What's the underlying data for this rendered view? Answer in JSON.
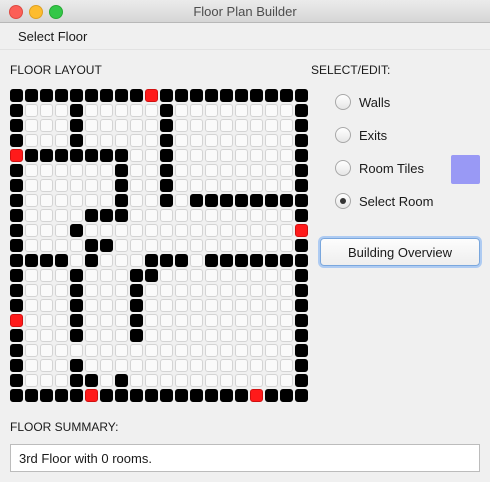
{
  "window": {
    "title": "Floor Plan Builder"
  },
  "menu": {
    "select_floor": "Select Floor"
  },
  "layout": {
    "heading": "FLOOR LAYOUT",
    "legend": {
      "#": "wall",
      ".": "floor",
      "R": "exit"
    },
    "grid": [
      "#########R##########",
      "#...#.....#........#",
      "#...#.....#........#",
      "#...#.....#........#",
      "R#######..#........#",
      "#......#..#........#",
      "#......#..#........#",
      "#......#..#.########",
      "#....###...........#",
      "#...#..............R",
      "#....##............#",
      "####.#...###.#######",
      "#...#...##.........#",
      "#...#...#..........#",
      "#...#...#..........#",
      "R...#...#..........#",
      "#...#...#..........#",
      "#..................#",
      "#...#..............#",
      "#...##.#...........#",
      "#####R##########R###"
    ]
  },
  "select_edit": {
    "heading": "SELECT/EDIT:",
    "options": [
      {
        "label": "Walls",
        "checked": false
      },
      {
        "label": "Exits",
        "checked": false
      },
      {
        "label": "Room Tiles",
        "checked": false
      },
      {
        "label": "Select Room",
        "checked": true
      }
    ],
    "room_tile_color": "#9999f5"
  },
  "actions": {
    "building_overview": "Building Overview"
  },
  "summary": {
    "heading": "FLOOR SUMMARY:",
    "text": "3rd Floor with 0 rooms."
  }
}
